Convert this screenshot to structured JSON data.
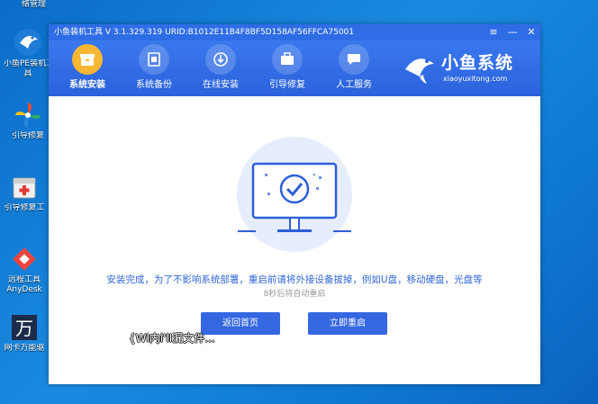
{
  "desktop": {
    "icons": [
      {
        "label": "络管理"
      },
      {
        "label": "小鱼PE装机工"
      },
      {
        "label": "具"
      },
      {
        "label": "引导修复"
      },
      {
        "label": "引导修复工"
      },
      {
        "label": "远程工具"
      },
      {
        "label": "AnyDesk"
      },
      {
        "label": "网卡万能驱"
      }
    ]
  },
  "window": {
    "title": "小鱼装机工具 V 3.1.329.319 URID:B1012E11B4F8BF5D158AF56FFCA75001",
    "controls": {
      "menu": "≡",
      "minimize": "—",
      "close": "✕"
    },
    "nav": [
      {
        "label": "系统安装",
        "icon": "install-box-icon",
        "active": true
      },
      {
        "label": "系统备份",
        "icon": "backup-icon"
      },
      {
        "label": "在线安装",
        "icon": "download-icon"
      },
      {
        "label": "引导修复",
        "icon": "toolbox-icon"
      },
      {
        "label": "人工服务",
        "icon": "chat-icon"
      }
    ],
    "brand": {
      "name": "小鱼系统",
      "url": "xiaoyuxitong.com"
    },
    "message": "安装完成，为了不影响系统部署，重启前请将外接设备拔掉，例如U盘，移动硬盘，光盘等",
    "countdown": "8秒后将自动重启",
    "buttons": {
      "home": "返回首页",
      "restart": "立即重启"
    },
    "overlay": "{Wl内i'lI漏文件..."
  },
  "colors": {
    "accent": "#2f6de6",
    "button": "#3567e0",
    "active_nav": "#f7b733",
    "message": "#2f66d8"
  }
}
